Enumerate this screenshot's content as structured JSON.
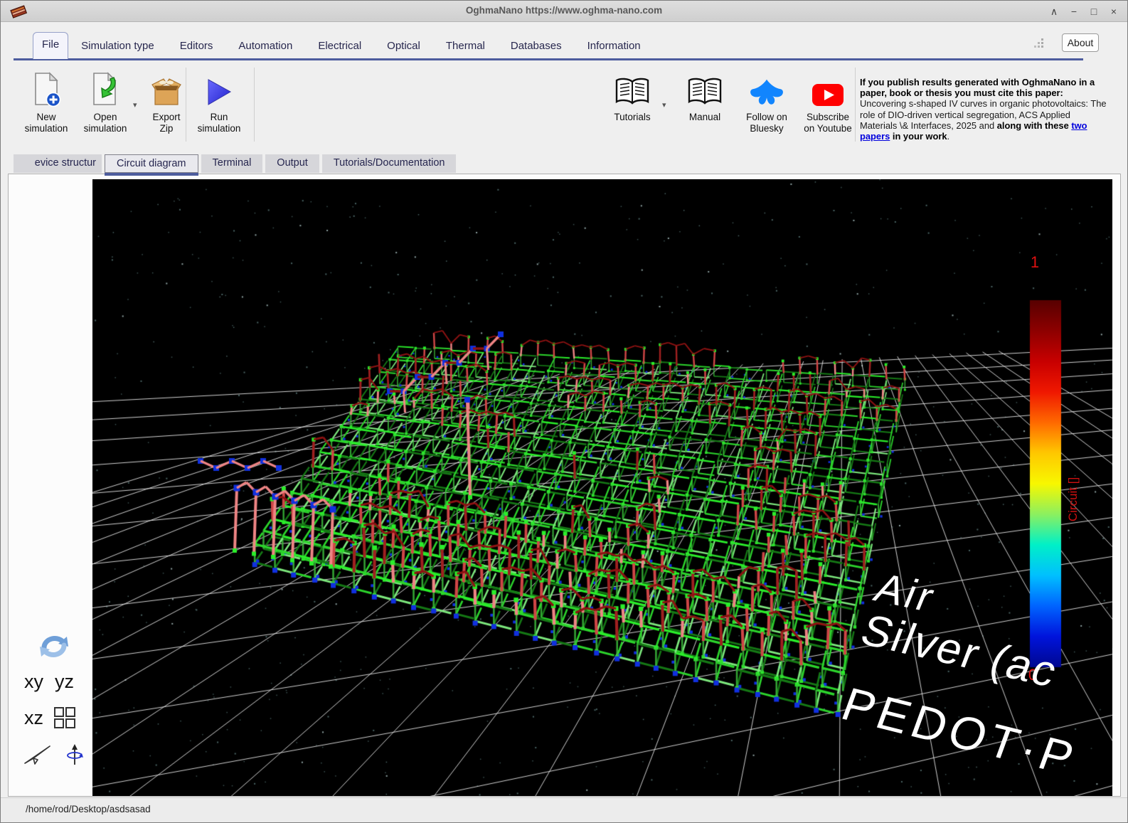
{
  "window": {
    "title": "OghmaNano https://www.oghma-nano.com",
    "controls": [
      "∧",
      "−",
      "□",
      "×"
    ]
  },
  "icons": {
    "caret": "▾"
  },
  "menubar": {
    "items": [
      "File",
      "Simulation type",
      "Editors",
      "Automation",
      "Electrical",
      "Optical",
      "Thermal",
      "Databases",
      "Information"
    ],
    "active_index": 0,
    "about_label": "About"
  },
  "toolbar": {
    "left": [
      {
        "id": "new-simulation",
        "line1": "New",
        "line2": "simulation"
      },
      {
        "id": "open-simulation",
        "line1": "Open",
        "line2": "simulation"
      },
      {
        "id": "export-zip",
        "line1": "Export",
        "line2": "Zip"
      },
      {
        "id": "run-simulation",
        "line1": "Run",
        "line2": "simulation"
      }
    ],
    "right": [
      {
        "id": "tutorials",
        "line1": "Tutorials",
        "line2": ""
      },
      {
        "id": "manual",
        "line1": "Manual",
        "line2": ""
      },
      {
        "id": "bluesky",
        "line1": "Follow on",
        "line2": "Bluesky"
      },
      {
        "id": "youtube",
        "line1": "Subscribe",
        "line2": "on Youtube"
      }
    ]
  },
  "citation": {
    "segments": [
      {
        "style": "bold",
        "text": "If you publish results generated with OghmaNano in a paper, book or thesis you must cite this paper: "
      },
      {
        "style": "normal",
        "text": "Uncovering s-shaped IV curves in organic photovoltaics: The role of DIO-driven vertical segregation, ACS Applied Materials \\& Interfaces, 2025 and "
      },
      {
        "style": "bold",
        "text": "along with these "
      },
      {
        "style": "link",
        "text": "two papers"
      },
      {
        "style": "bold",
        "text": " in your work"
      },
      {
        "style": "normal",
        "text": "."
      }
    ]
  },
  "view_tabs": {
    "items": [
      "evice structur",
      "Circuit diagram",
      "Terminal",
      "Output",
      "Tutorials/Documentation"
    ],
    "active_index": 1
  },
  "scene": {
    "colorbar": {
      "max_label": "1",
      "min_label": "0",
      "axis_label": "Circuit []",
      "stops_top_to_bottom": [
        "#580000",
        "#8e0000",
        "#c80000",
        "#f01800",
        "#ff6a00",
        "#ffc800",
        "#f8f800",
        "#8cf060",
        "#00f0c8",
        "#00c0ff",
        "#0064ff",
        "#0014dc",
        "#000890"
      ]
    },
    "layer_labels": [
      "Air",
      "Silver (ac",
      "PEDOT·P"
    ],
    "palette": {
      "background": "#000000",
      "grid_line": "#e8e8e8",
      "star": "#3c5252",
      "lattice_bright": "#2cd42c",
      "lattice_dark": "#157815",
      "lattice_light": "#7de87d",
      "node_green": "#2aee2a",
      "node_blue": "#1030e0",
      "bar_salmon": "#ee8484",
      "bar_red": "#cf4646",
      "bar_dark_red": "#a02020",
      "connector_red": "#8e1212"
    }
  },
  "side_controls": {
    "xy": "xy",
    "yz": "yz",
    "xz": "xz"
  },
  "statusbar": {
    "path": "/home/rod/Desktop/asdsasad"
  }
}
